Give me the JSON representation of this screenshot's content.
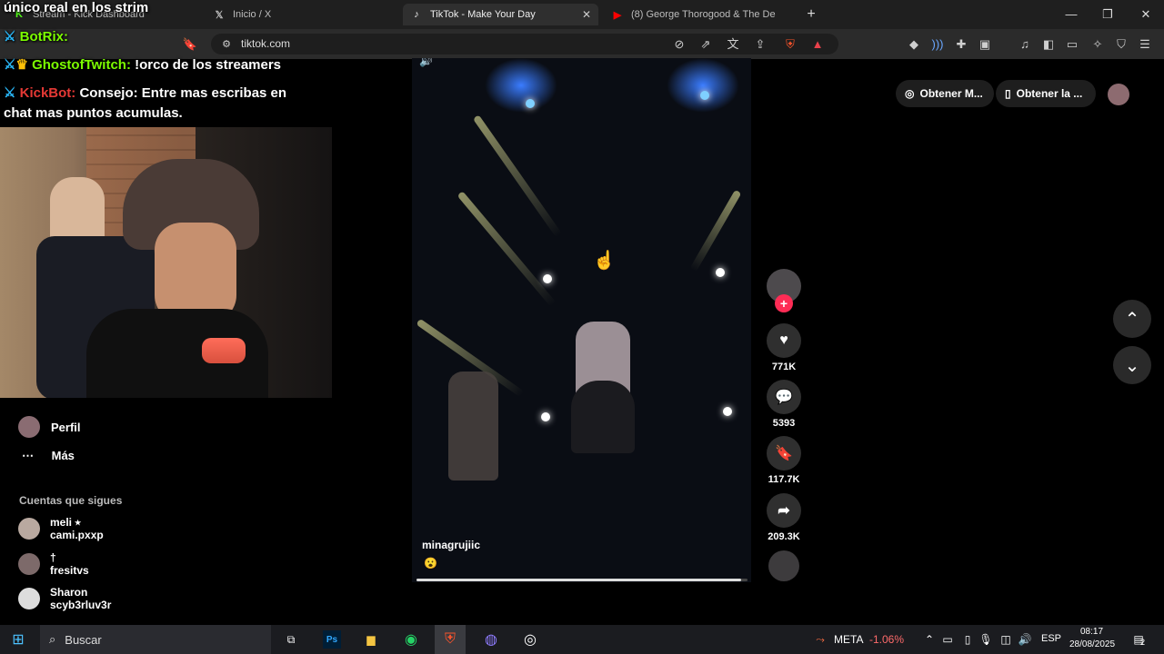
{
  "browser": {
    "tabs": [
      {
        "label": "Stream - Kick Dashboard",
        "icon": "kick-icon"
      },
      {
        "label": "Inicio / X",
        "icon": "x-logo-icon"
      },
      {
        "label": "TikTok - Make Your Day",
        "icon": "tiktok-icon"
      },
      {
        "label": "(8) George Thorogood & The De",
        "icon": "youtube-icon"
      }
    ],
    "url": "tiktok.com"
  },
  "overlay": {
    "top_text": "único real en los strim",
    "chat": [
      {
        "user": "BotRix:",
        "message": ""
      },
      {
        "user": "GhostofTwitch:",
        "message": "!orco de los streamers"
      },
      {
        "user": "KickBot:",
        "message": "Consejo: Entre mas escribas en"
      },
      {
        "user": "",
        "message": "chat mas puntos acumulas."
      }
    ]
  },
  "tiktok": {
    "logo": "TikTok",
    "sidebar": {
      "profile": "Perfil",
      "more": "Más",
      "following_heading": "Cuentas que sigues",
      "following": [
        {
          "name": "meli ⭒",
          "handle": "cami.pxxp"
        },
        {
          "name": "†",
          "handle": "fresitvs"
        },
        {
          "name": "Sharon",
          "handle": "scyb3rluv3r"
        }
      ]
    },
    "top_buttons": [
      "Obtener M...",
      "Obtener la ..."
    ],
    "video": {
      "author": "minagrujiic",
      "caption": "😮",
      "progress": 0.98
    },
    "actions": {
      "likes": "771K",
      "comments": "5393",
      "saves": "117.7K",
      "shares": "209.3K"
    }
  },
  "taskbar": {
    "search": "Buscar",
    "stock_name": "META",
    "stock_change": "-1.06%",
    "lang": "ESP",
    "time": "08:17",
    "date": "28/08/2025",
    "notif_count": "2"
  },
  "colors": {
    "accent_pink": "#fe2c55",
    "stock_red": "#ff6b6b",
    "chat_green": "#7cfc00"
  }
}
